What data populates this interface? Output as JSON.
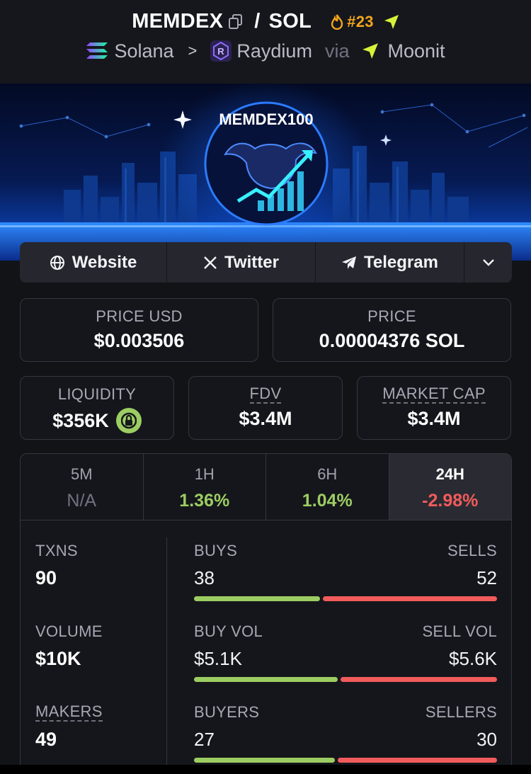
{
  "header": {
    "token": "MEMDEX",
    "slash": "/",
    "quote": "SOL",
    "rank": "#23",
    "chain": "Solana",
    "chevron": ">",
    "dex": "Raydium",
    "via": "via",
    "launchpad": "Moonit"
  },
  "banner": {
    "logo_text": "MEMDEX100"
  },
  "socials": {
    "website": "Website",
    "twitter": "Twitter",
    "telegram": "Telegram"
  },
  "price": {
    "usd_label": "PRICE USD",
    "usd_value": "$0.003506",
    "native_label": "PRICE",
    "native_value": "0.00004376 SOL"
  },
  "metrics": {
    "liquidity_label": "LIQUIDITY",
    "liquidity_value": "$356K",
    "fdv_label": "FDV",
    "fdv_value": "$3.4M",
    "mcap_label": "MARKET CAP",
    "mcap_value": "$3.4M"
  },
  "timeframes": [
    {
      "label": "5M",
      "value": "N/A"
    },
    {
      "label": "1H",
      "value": "1.36%"
    },
    {
      "label": "6H",
      "value": "1.04%"
    },
    {
      "label": "24H",
      "value": "-2.98%"
    }
  ],
  "stats": {
    "txns_label": "TXNS",
    "txns_value": "90",
    "volume_label": "VOLUME",
    "volume_value": "$10K",
    "makers_label": "MAKERS",
    "makers_value": "49",
    "buys_label": "BUYS",
    "buys_value": "38",
    "sells_label": "SELLS",
    "sells_value": "52",
    "buy_vol_label": "BUY VOL",
    "buy_vol_value": "$5.1K",
    "sell_vol_label": "SELL VOL",
    "sell_vol_value": "$5.6K",
    "buyers_label": "BUYERS",
    "buyers_value": "27",
    "sellers_label": "SELLERS",
    "sellers_value": "30"
  },
  "bars": {
    "buys_fraction": 0.42,
    "buy_vol_fraction": 0.48,
    "buyers_fraction": 0.47
  },
  "colors": {
    "positive": "#9ccd62",
    "negative": "#f15b5b",
    "rank": "#f2a51c",
    "moonit": "#d8f23a"
  }
}
